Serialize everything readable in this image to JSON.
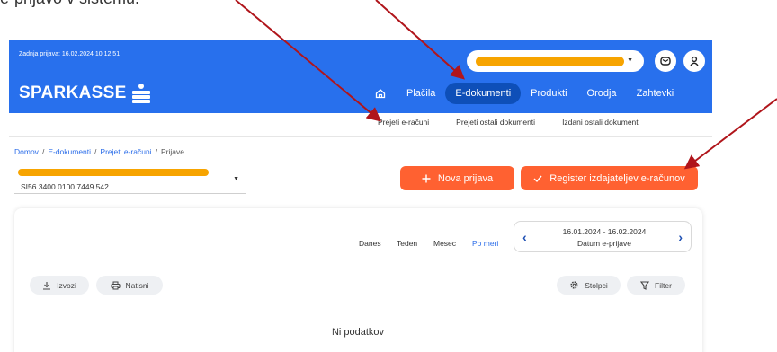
{
  "intro_text": "e-prijavo v sistemu.",
  "header": {
    "last_login": "Zadnja prijava: 16.02.2024 10:12:51",
    "logo_text": "SPARKASSE",
    "nav": [
      "Plačila",
      "E-dokumenti",
      "Produkti",
      "Orodja",
      "Zahtevki"
    ],
    "active_nav": "E-dokumenti"
  },
  "subnav": [
    "Prejeti e-računi",
    "Prejeti ostali dokumenti",
    "Izdani ostali dokumenti"
  ],
  "breadcrumb": [
    "Domov",
    "E-dokumenti",
    "Prejeti e-računi",
    "Prijave"
  ],
  "account": {
    "iban": "SI56 3400 0100 7449 542"
  },
  "actions": {
    "new_label": "Nova prijava",
    "register_label": "Register izdajateljev e-računov"
  },
  "periods": [
    "Danes",
    "Teden",
    "Mesec",
    "Po meri"
  ],
  "active_period": "Po meri",
  "date_range": {
    "range": "16.01.2024 - 16.02.2024",
    "label": "Datum e-prijave"
  },
  "toolbar": {
    "export": "Izvozi",
    "print": "Natisni",
    "columns": "Stolpci",
    "filter": "Filter"
  },
  "empty_text": "Ni podatkov",
  "colors": {
    "brand_blue": "#2870ed",
    "accent_orange": "#ff6131",
    "redaction": "#f7a400",
    "arrow": "#b0151b"
  },
  "icons": [
    "home-icon",
    "mail-icon",
    "user-icon",
    "plus-icon",
    "check-icon",
    "download-icon",
    "printer-icon",
    "gear-icon",
    "filter-icon",
    "chevron-left-icon",
    "chevron-right-icon"
  ]
}
